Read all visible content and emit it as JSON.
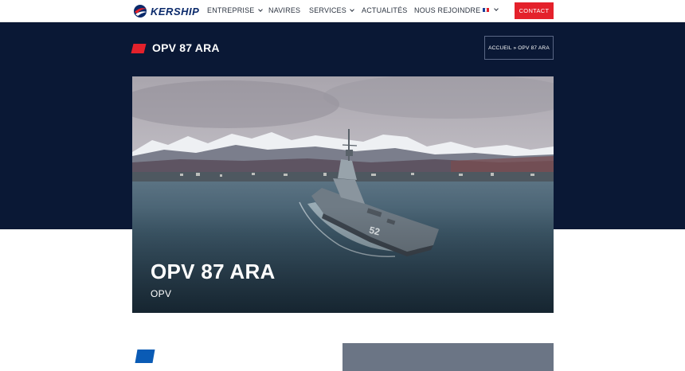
{
  "brand": {
    "name_left": "KER",
    "name_right": "SHIP"
  },
  "nav": {
    "items": [
      {
        "label": "ENTREPRISE",
        "has_dropdown": true
      },
      {
        "label": "NAVIRES",
        "has_dropdown": false
      },
      {
        "label": "SERVICES",
        "has_dropdown": true
      },
      {
        "label": "ACTUALITÉS",
        "has_dropdown": false
      },
      {
        "label": "NOUS REJOINDRE",
        "has_dropdown": false
      }
    ],
    "language": {
      "flag": "fr-flag-icon",
      "colors": [
        "#1b3f9a",
        "#ffffff",
        "#e4212b"
      ]
    },
    "contact_label": "CONTACT"
  },
  "header": {
    "title": "OPV 87 ARA",
    "breadcrumb": "ACCUEIL » OPV 87 ARA"
  },
  "hero": {
    "title": "OPV 87 ARA",
    "subtitle": "OPV",
    "hull_number": "52"
  },
  "colors": {
    "accent_red": "#e4212b",
    "navy": "#0a1835",
    "accent_blue": "#0a5bb5",
    "panel_grey": "#6b7585"
  }
}
